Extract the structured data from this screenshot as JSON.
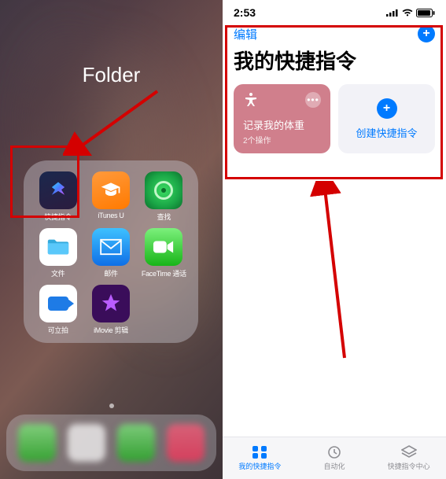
{
  "left": {
    "folder_title": "Folder",
    "apps": [
      {
        "label": "快捷指令"
      },
      {
        "label": "iTunes U"
      },
      {
        "label": "查找"
      },
      {
        "label": "文件"
      },
      {
        "label": "邮件"
      },
      {
        "label": "FaceTime 通话"
      },
      {
        "label": "可立拍"
      },
      {
        "label": "iMovie 剪辑"
      }
    ]
  },
  "right": {
    "status_time": "2:53",
    "edit_label": "编辑",
    "page_title": "我的快捷指令",
    "card_record": {
      "title": "记录我的体重",
      "subtitle": "2个操作"
    },
    "card_create": {
      "label": "创建快捷指令"
    },
    "tabs": {
      "shortcuts": "我的快捷指令",
      "automation": "自动化",
      "gallery": "快捷指令中心"
    }
  }
}
